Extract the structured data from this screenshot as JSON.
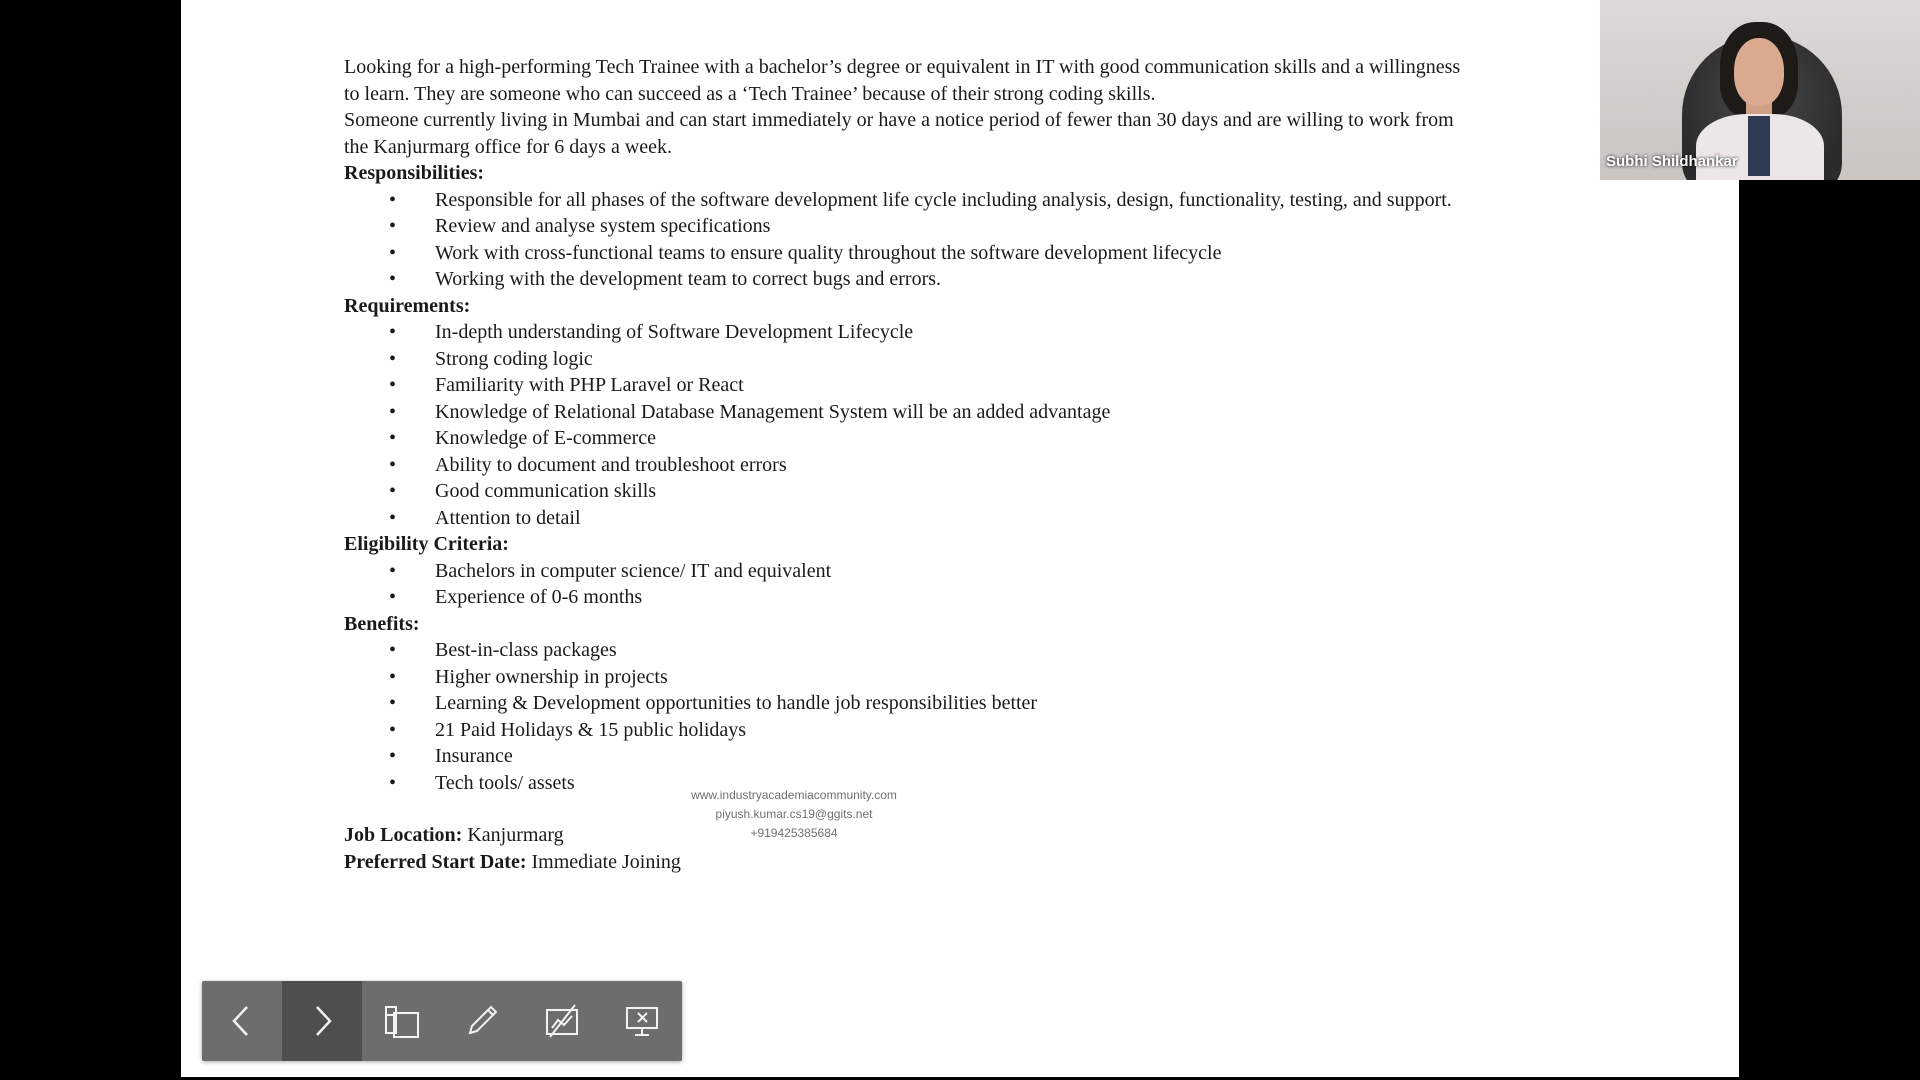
{
  "document": {
    "intro": [
      "Looking for a high-performing Tech Trainee with a bachelor’s degree or equivalent in IT with good communication skills and a willingness",
      "to learn. They are someone who can succeed as a ‘Tech Trainee’ because of their strong coding skills.",
      "Someone currently living in Mumbai and can start immediately or have a notice period of fewer than 30 days and are willing to work from",
      "the Kanjurmarg office for 6 days a week."
    ],
    "responsibilities": {
      "heading": "Responsibilities:",
      "items": [
        "Responsible for all phases of the software development life cycle including analysis, design, functionality, testing, and support.",
        "Review and analyse system specifications",
        "Work with cross-functional teams to ensure quality throughout the software development lifecycle",
        "Working with the development team to correct bugs and errors."
      ]
    },
    "requirements": {
      "heading": "Requirements:",
      "items": [
        "In-depth understanding of Software Development Lifecycle",
        "Strong coding logic",
        "Familiarity with PHP Laravel or React",
        "Knowledge of Relational Database Management System will be an added advantage",
        "Knowledge of E-commerce",
        "Ability to document and troubleshoot errors",
        "Good communication skills",
        "Attention to detail"
      ]
    },
    "eligibility": {
      "heading": "Eligibility Criteria:",
      "items": [
        "Bachelors in computer science/ IT and equivalent",
        "Experience of 0-6 months"
      ]
    },
    "benefits": {
      "heading": "Benefits:",
      "items": [
        "Best-in-class packages",
        "Higher ownership in projects",
        "Learning & Development opportunities to handle job responsibilities better",
        "21 Paid Holidays & 15 public holidays",
        "Insurance",
        "Tech tools/ assets"
      ]
    },
    "job_location": {
      "label": "Job Location:",
      "value": "Kanjurmarg"
    },
    "start_date": {
      "label": "Preferred Start Date:",
      "value": "Immediate Joining"
    }
  },
  "watermark": {
    "site": "www.industryacademiacommunity.com",
    "email": "piyush.kumar.cs19@ggits.net",
    "phone": "+919425385684"
  },
  "participant": {
    "name": "Subhi Shildhankar"
  },
  "toolbar": {
    "buttons": [
      {
        "icon": "chevron-left-icon",
        "active": false
      },
      {
        "icon": "chevron-right-icon",
        "active": true
      },
      {
        "icon": "slides-icon",
        "active": false
      },
      {
        "icon": "pen-icon",
        "active": false
      },
      {
        "icon": "hide-annotations-icon",
        "active": false
      },
      {
        "icon": "end-slideshow-icon",
        "active": false
      }
    ]
  }
}
